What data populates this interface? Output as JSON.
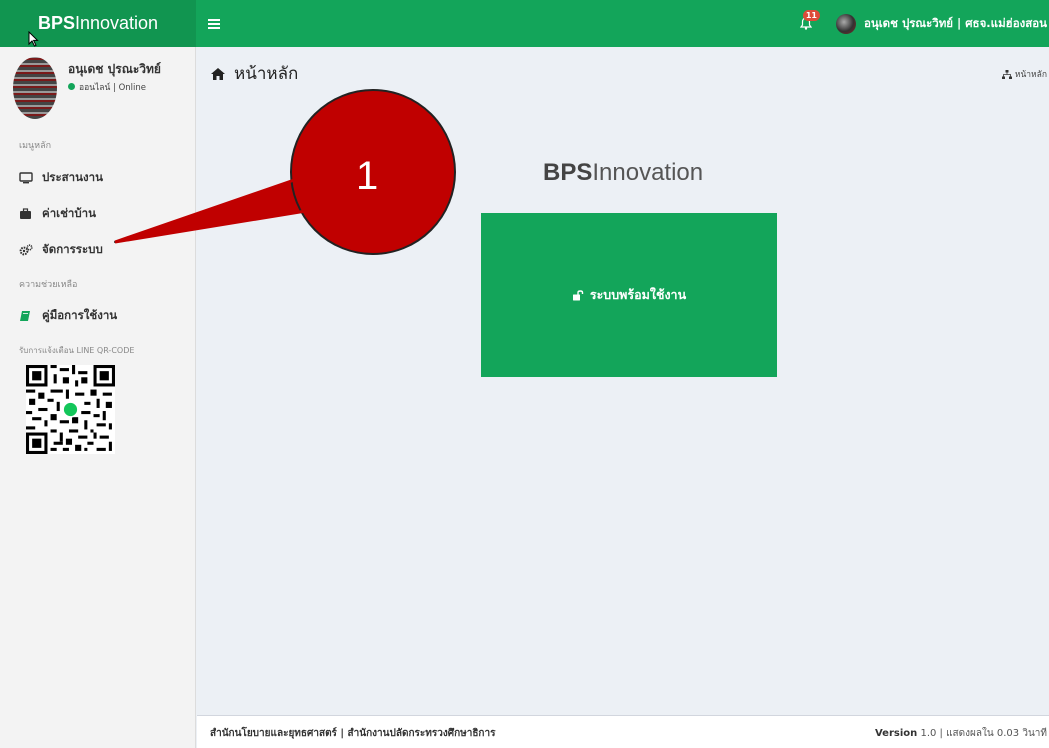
{
  "topbar": {
    "logo_bold": "BPS",
    "logo_rest": "Innovation",
    "menu_icon": "hamburger-icon",
    "notification_count": "11",
    "user_label": "อนุเดช ปุรณะวิทย์ | ศธจ.แม่ฮ่องสอน"
  },
  "sidebar": {
    "user_name": "อนุเดช ปุรณะวิทย์",
    "status_th": "ออนไลน์",
    "status_sep": "|",
    "status_en": "Online",
    "main_menu_header": "เมนูหลัก",
    "items": [
      {
        "label": "ประสานงาน",
        "icon": "monitor-icon"
      },
      {
        "label": "ค่าเช่าบ้าน",
        "icon": "briefcase-icon"
      },
      {
        "label": "จัดการระบบ",
        "icon": "gears-icon"
      }
    ],
    "help_header": "ความช่วยเหลือ",
    "manual_label": "คู่มือการใช้งาน",
    "line_header": "รับการแจ้งเตือน LINE QR-CODE"
  },
  "content": {
    "page_title": "หน้าหลัก",
    "breadcrumb": "หน้าหลัก",
    "brand_bold": "BPS",
    "brand_rest": "Innovation",
    "ready_label": "ระบบพร้อมใช้งาน"
  },
  "footer": {
    "left": "สำนักนโยบายและยุทธศาสตร์ | สำนักงานปลัดกระทรวงศึกษาธิการ",
    "version_label": "Version",
    "version_value": "1.0 | แสดงผลใน 0.03 วินาที"
  },
  "callout": {
    "number": "1",
    "color": "#c00000"
  },
  "colors": {
    "brand_green": "#13a55a",
    "logo_green": "#119550",
    "sidebar_bg": "#f3f3f3",
    "content_bg": "#ecf0f5"
  }
}
